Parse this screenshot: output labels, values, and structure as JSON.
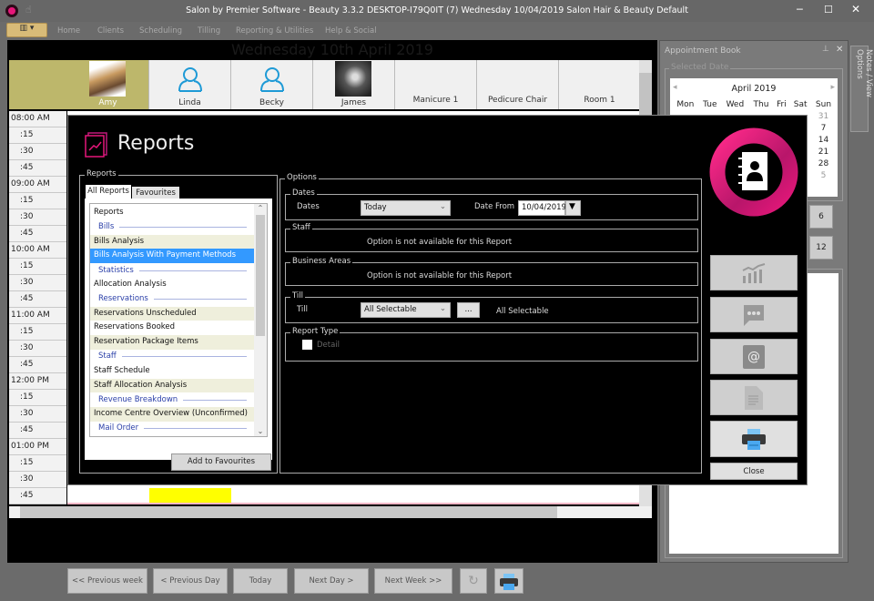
{
  "window": {
    "title": "Salon by Premier Software - Beauty 3.3.2 DESKTOP-I79Q0IT (7) Wednesday 10/04/2019 Salon Hair & Beauty Default"
  },
  "ribbon": {
    "tabs": [
      "Home",
      "Clients",
      "Scheduling",
      "Tilling",
      "Reporting & Utilities",
      "Help & Social"
    ]
  },
  "diary": {
    "date_heading": "Wednesday 10th April 2019",
    "resources": [
      "Amy",
      "Linda",
      "Becky",
      "James",
      "Manicure 1",
      "Pedicure Chair",
      "Room 1"
    ],
    "times": [
      "08:00 AM",
      ":15",
      ":30",
      ":45",
      "09:00 AM",
      ":15",
      ":30",
      ":45",
      "10:00 AM",
      ":15",
      ":30",
      ":45",
      "11:00 AM",
      ":15",
      ":30",
      ":45",
      "12:00 PM",
      ":15",
      ":30",
      ":45",
      "01:00 PM",
      ":15",
      ":30",
      ":45"
    ],
    "nav": {
      "prev_week": "<< Previous week",
      "prev_day": "< Previous Day",
      "today": "Today",
      "next_day": "Next Day >",
      "next_week": "Next Week >>"
    }
  },
  "appointment_book": {
    "title": "Appointment Book",
    "selected_date_label": "Selected Date",
    "month": "April 2019",
    "weekdays": [
      "Mon",
      "Tue",
      "Wed",
      "Thu",
      "Fri",
      "Sat",
      "Sun"
    ],
    "sunday_column": [
      "31",
      "7",
      "14",
      "21",
      "28",
      "5"
    ],
    "buttons": [
      "6",
      "12"
    ],
    "notes_tab": "Notes / View Options"
  },
  "reports": {
    "title": "Reports",
    "group_label": "Reports",
    "tabs": [
      "All Reports",
      "Favourites"
    ],
    "items": [
      {
        "label": "Reports",
        "type": "root"
      },
      {
        "label": "Bills",
        "type": "grp"
      },
      {
        "label": "Bills Analysis",
        "type": "alt"
      },
      {
        "label": "Bills Analysis With Payment Methods",
        "type": "sel"
      },
      {
        "label": "Statistics",
        "type": "grp"
      },
      {
        "label": "Allocation Analysis",
        "type": ""
      },
      {
        "label": "Reservations",
        "type": "grp"
      },
      {
        "label": "Reservations Unscheduled",
        "type": "alt"
      },
      {
        "label": "Reservations Booked",
        "type": ""
      },
      {
        "label": "Reservation Package Items",
        "type": "alt"
      },
      {
        "label": "Staff",
        "type": "grp"
      },
      {
        "label": "Staff Schedule",
        "type": ""
      },
      {
        "label": "Staff Allocation Analysis",
        "type": "alt"
      },
      {
        "label": "Revenue Breakdown",
        "type": "grp"
      },
      {
        "label": "Income Centre Overview (Unconfirmed)",
        "type": "alt"
      },
      {
        "label": "Mail Order",
        "type": "grp"
      }
    ],
    "add_favourites": "Add to Favourites",
    "options": {
      "label": "Options",
      "dates": {
        "legend": "Dates",
        "label": "Dates",
        "value": "Today",
        "date_from_label": "Date From",
        "date_from": "10/04/2019"
      },
      "staff": {
        "legend": "Staff",
        "message": "Option is not available for this Report"
      },
      "business_areas": {
        "legend": "Business Areas",
        "message": "Option is not available for this Report"
      },
      "till": {
        "legend": "Till",
        "label": "Till",
        "value": "All Selectable",
        "browse": "...",
        "summary": "All Selectable"
      },
      "report_type": {
        "legend": "Report Type",
        "detail": "Detail",
        "detail_checked": false
      }
    },
    "close": "Close"
  },
  "colors": {
    "accent": "#e6177a",
    "selection": "#3399ff",
    "highlight_row": "#efefdc",
    "amy_column": "#bdb76b",
    "yellow_slot": "#ffff00"
  }
}
